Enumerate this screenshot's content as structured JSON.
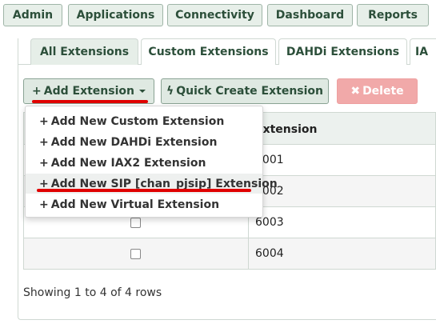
{
  "top_nav": [
    "Admin",
    "Applications",
    "Connectivity",
    "Dashboard",
    "Reports"
  ],
  "tabs": [
    "All Extensions",
    "Custom Extensions",
    "DAHDi Extensions",
    "IA"
  ],
  "toolbar": {
    "add_label": "Add Extension",
    "quick_label": "Quick Create Extension",
    "delete_label": "Delete"
  },
  "icons": {
    "plus": "+",
    "bolt": "ϟ",
    "times": "✖"
  },
  "dropdown": [
    "Add New Custom Extension",
    "Add New DAHDi Extension",
    "Add New IAX2 Extension",
    "Add New SIP [chan_pjsip] Extension",
    "Add New Virtual Extension"
  ],
  "table": {
    "header": "Extension",
    "rows": [
      "6001",
      "6002",
      "6003",
      "6004"
    ]
  },
  "footer": "Showing 1 to 4 of 4 rows",
  "colors": {
    "accent_green": "#2c4f3a",
    "delete_red": "#f1a9a9",
    "annotation_red": "#e00000"
  }
}
